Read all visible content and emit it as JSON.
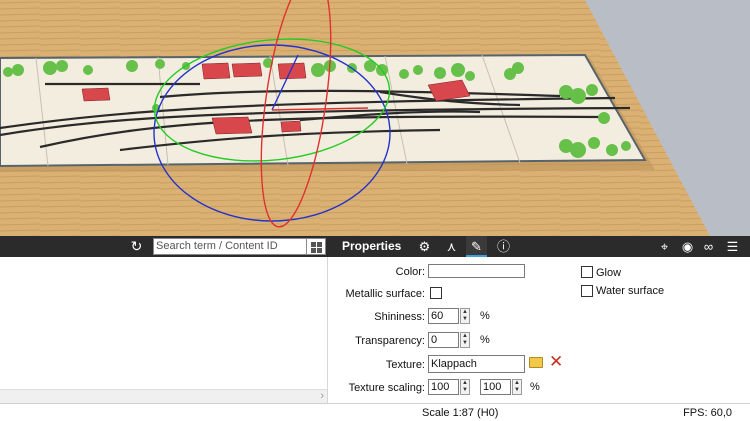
{
  "toolbar": {
    "refresh_icon": "refresh-icon",
    "search_placeholder": "Search term / Content ID",
    "grid_icon": "grid-view-icon",
    "properties_title": "Properties",
    "tab_icons": [
      "gear-icon",
      "axis-icon",
      "paint-brush-icon",
      "info-icon"
    ],
    "active_tab": "paint-brush-icon",
    "right_icons": [
      "pin-icon",
      "eye-icon",
      "link-icon",
      "menu-icon"
    ]
  },
  "properties": {
    "color_label": "Color:",
    "metallic_label": "Metallic surface:",
    "shininess_label": "Shininess:",
    "shininess_value": "60",
    "shininess_unit": "%",
    "transparency_label": "Transparency:",
    "transparency_value": "0",
    "transparency_unit": "%",
    "texture_label": "Texture:",
    "texture_value": "Klappach",
    "texture_scaling_label": "Texture scaling:",
    "texture_scaling_x": "100",
    "texture_scaling_y": "100",
    "texture_scaling_unit": "%",
    "glow_label": "Glow",
    "water_label": "Water surface"
  },
  "status": {
    "scale": "Scale 1:87 (H0)",
    "fps": "FPS: 60,0"
  },
  "colors": {
    "toolbar_bg": "#2b2b2b",
    "accent": "#3aa0e0",
    "table_wood": "#d9ad6e",
    "layout_base": "#f3ede0",
    "building_red": "#d8474b",
    "tree_green": "#66c04a",
    "delete_red": "#c83020"
  }
}
